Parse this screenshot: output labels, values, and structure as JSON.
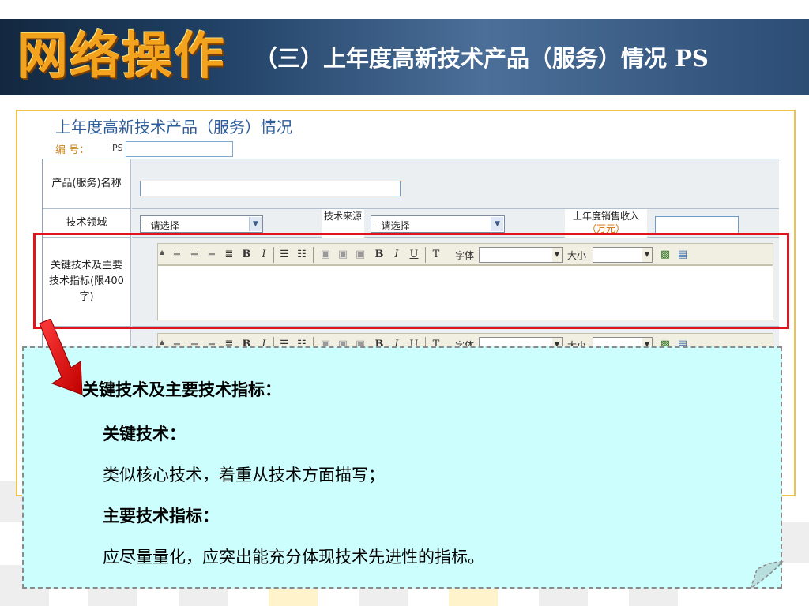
{
  "header": {
    "logo_text": "网络操作",
    "title": "（三）上年度高新技术产品（服务）情况  PS"
  },
  "form": {
    "title": "上年度高新技术产品（服务）情况",
    "code_label": "编  号：",
    "code_prefix": "PS",
    "rows": {
      "product_name_label": "产品(服务)名称",
      "tech_field_label": "技术领域",
      "tech_field_select": "--请选择",
      "tech_source_label": "技术来源",
      "tech_source_select": "--请选择",
      "sales_label": "上年度销售收入",
      "sales_unit": "（万元）",
      "key_tech_label": "关键技术及主要技术指标(限400字)"
    },
    "toolbar": {
      "font_label": "字体",
      "size_label": "大小",
      "bold": "B",
      "italic": "I",
      "underline": "U"
    }
  },
  "callout": {
    "heading": "关键技术及主要技术指标：",
    "key_tech_title": "关键技术：",
    "key_tech_desc": "类似核心技术，着重从技术方面描写；",
    "indicators_title": "主要技术指标：",
    "indicators_desc": "应尽量量化，应突出能充分体现技术先进性的指标。"
  },
  "colors": {
    "highlight": "#e0141c",
    "callout_bg": "#ccfefe",
    "logo": "#f2a21c"
  }
}
